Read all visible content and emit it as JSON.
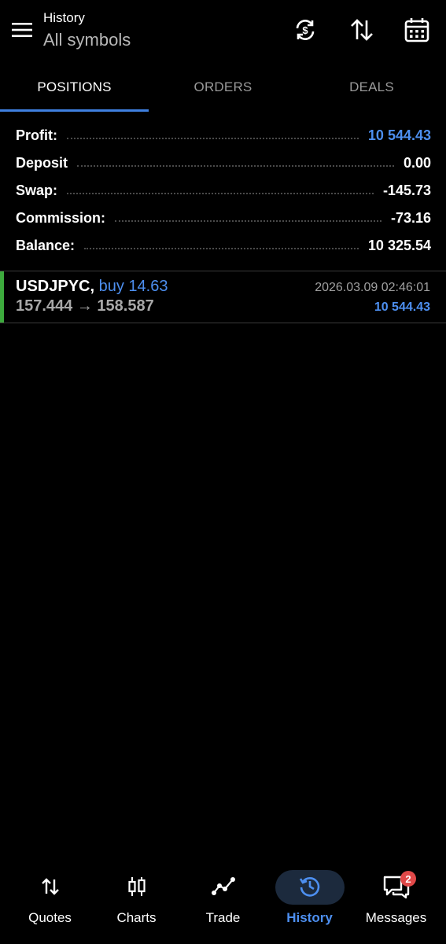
{
  "header": {
    "title": "History",
    "subtitle": "All symbols",
    "icons": [
      "menu-icon",
      "sync-icon",
      "sort-icon",
      "calendar-icon"
    ]
  },
  "tabs": [
    {
      "label": "POSITIONS",
      "active": true
    },
    {
      "label": "ORDERS",
      "active": false
    },
    {
      "label": "DEALS",
      "active": false
    }
  ],
  "summary": {
    "rows": [
      {
        "label": "Profit:",
        "value": "10 544.43",
        "color": "#4d8ff0"
      },
      {
        "label": "Deposit",
        "value": "0.00",
        "color": "#ffffff"
      },
      {
        "label": "Swap:",
        "value": "-145.73",
        "color": "#ffffff"
      },
      {
        "label": "Commission:",
        "value": "-73.16",
        "color": "#ffffff"
      },
      {
        "label": "Balance:",
        "value": "10 325.54",
        "color": "#ffffff"
      }
    ]
  },
  "position": {
    "symbol": "USDJPYC,",
    "side": "buy 14.63",
    "prices": "157.444 → 158.587",
    "time": "2026.03.09 02:46:01",
    "profit": "10 544.43",
    "side_color": "#4d8ff0",
    "bar_color": "#3daa3d"
  },
  "nav": {
    "items": [
      {
        "label": "Quotes",
        "icon": "quotes-icon",
        "active": false
      },
      {
        "label": "Charts",
        "icon": "charts-icon",
        "active": false
      },
      {
        "label": "Trade",
        "icon": "trade-icon",
        "active": false
      },
      {
        "label": "History",
        "icon": "history-icon",
        "active": true
      },
      {
        "label": "Messages",
        "icon": "messages-icon",
        "active": false,
        "badge": "2"
      }
    ]
  },
  "colors": {
    "accent": "#4d8ff0",
    "background": "#000000",
    "badge": "#e04848"
  }
}
